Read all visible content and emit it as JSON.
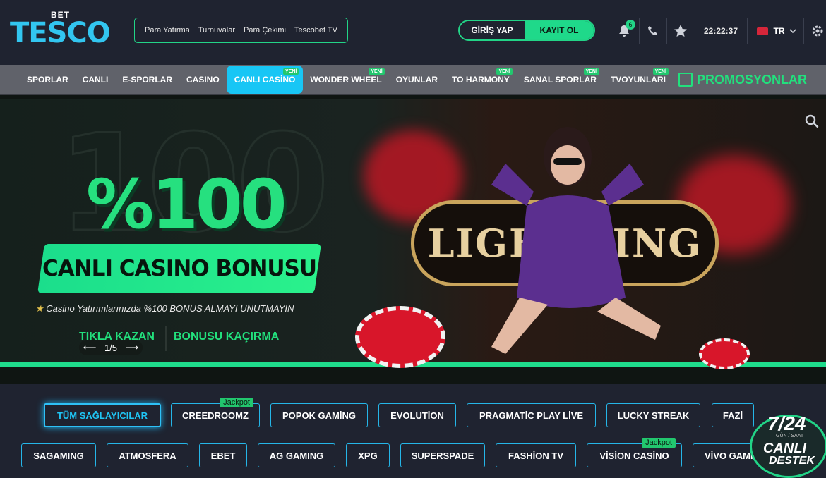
{
  "logo": {
    "bet": "BET",
    "name": "TESCO"
  },
  "quick_links": [
    "Para Yatırma",
    "Turnuvalar",
    "Para Çekimi",
    "Tescobet TV"
  ],
  "auth": {
    "login": "GİRİŞ YAP",
    "register": "KAYIT OL"
  },
  "notifications": {
    "count": "6",
    "icon": "bell-icon"
  },
  "clock": "22:22:37",
  "language": {
    "code": "TR",
    "flag_color": "#d6263a"
  },
  "nav": [
    {
      "label": "SPORLAR",
      "new": ""
    },
    {
      "label": "CANLI",
      "new": ""
    },
    {
      "label": "E-SPORLAR",
      "new": ""
    },
    {
      "label": "CASINO",
      "new": ""
    },
    {
      "label": "CANLI CASİNO",
      "new": "YENİ"
    },
    {
      "label": "WONDER WHEEL",
      "new": "YENİ"
    },
    {
      "label": "OYUNLAR",
      "new": ""
    },
    {
      "label": "TO HARMONY",
      "new": "YENİ"
    },
    {
      "label": "SANAL SPORLAR",
      "new": "YENİ"
    },
    {
      "label": "TVOYUNLARI",
      "new": "YENİ"
    }
  ],
  "promo_label": "PROMOSYONLAR",
  "banner": {
    "ghost": "100",
    "percent": "%100",
    "title": "CANLI CASINO BONUSU",
    "reminder": "Casino Yatırımlarınızda %100 BONUS ALMAYI UNUTMAYIN",
    "cta_left": "TIKLA KAZAN",
    "cta_right": "BONUSU KAÇIRMA",
    "pager": "1/5",
    "game_title": "LIGHTNING"
  },
  "providers_row1": [
    {
      "label": "TÜM SAĞLAYICILAR",
      "tag": ""
    },
    {
      "label": "CREEDROOMZ",
      "tag": "Jackpot"
    },
    {
      "label": "POPOK GAMİNG",
      "tag": ""
    },
    {
      "label": "EVOLUTİON",
      "tag": ""
    },
    {
      "label": "PRAGMATİC PLAY LİVE",
      "tag": ""
    },
    {
      "label": "LUCKY STREAK",
      "tag": ""
    },
    {
      "label": "FAZİ",
      "tag": ""
    }
  ],
  "providers_row2": [
    {
      "label": "SAGAMING",
      "tag": ""
    },
    {
      "label": "ATMOSFERA",
      "tag": ""
    },
    {
      "label": "EBET",
      "tag": ""
    },
    {
      "label": "AG GAMING",
      "tag": ""
    },
    {
      "label": "XPG",
      "tag": ""
    },
    {
      "label": "SUPERSPADE",
      "tag": ""
    },
    {
      "label": "FASHİON TV",
      "tag": ""
    },
    {
      "label": "VİSİON CASİNO",
      "tag": "Jackpot"
    },
    {
      "label": "VİVO GAMİNG",
      "tag": ""
    }
  ],
  "support": {
    "hours": "7/24",
    "sub": "GÜN / SAAT",
    "line1": "CANLI",
    "line2": "DESTEK"
  },
  "colors": {
    "accent_green": "#22d487",
    "accent_blue": "#18c6f5",
    "bg": "#1f2330"
  }
}
